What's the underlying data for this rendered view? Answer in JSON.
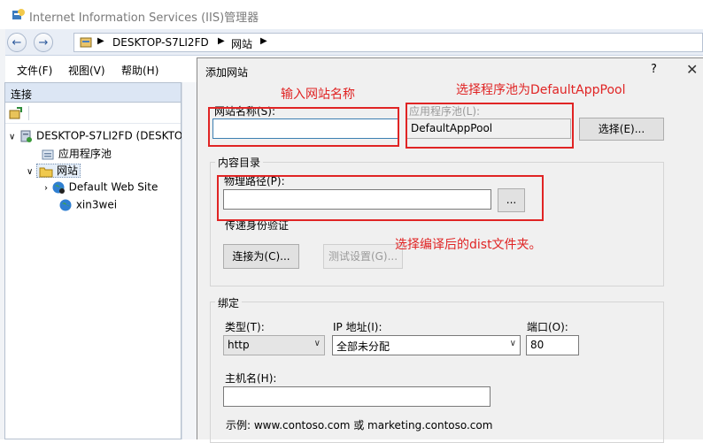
{
  "window": {
    "title": "Internet Information Services (IIS)管理器",
    "breadcrumb": [
      "DESKTOP-S7LI2FD",
      "网站"
    ]
  },
  "menu": {
    "file": "文件(F)",
    "view": "视图(V)",
    "help": "帮助(H)"
  },
  "connections": {
    "header": "连接",
    "tree": {
      "server": "DESKTOP-S7LI2FD (DESKTO",
      "app_pools": "应用程序池",
      "sites": "网站",
      "site1": "Default Web Site",
      "site2": "xin3wei"
    }
  },
  "dialog": {
    "title": "添加网站",
    "help": "?",
    "close": "✕",
    "site_name_label": "网站名称(S):",
    "site_name_value": "",
    "app_pool_label": "应用程序池(L):",
    "app_pool_value": "DefaultAppPool",
    "select_button": "选择(E)...",
    "content_dir_label": "内容目录",
    "physical_path_label": "物理路径(P):",
    "physical_path_value": "",
    "browse_button": "...",
    "passthrough_label": "传递身份验证",
    "connect_as_button": "连接为(C)...",
    "test_settings_button": "测试设置(G)...",
    "binding_label": "绑定",
    "type_label": "类型(T):",
    "type_value": "http",
    "ip_label": "IP 地址(I):",
    "ip_value": "全部未分配",
    "port_label": "端口(O):",
    "port_value": "80",
    "host_label": "主机名(H):",
    "host_value": "",
    "example_text": "示例: www.contoso.com 或 marketing.contoso.com"
  },
  "annotations": {
    "site_name_note": "输入网站名称",
    "app_pool_note": "选择程序池为DefaultAppPool",
    "path_note": "选择编译后的dist文件夹。",
    "color": "#e02424"
  }
}
